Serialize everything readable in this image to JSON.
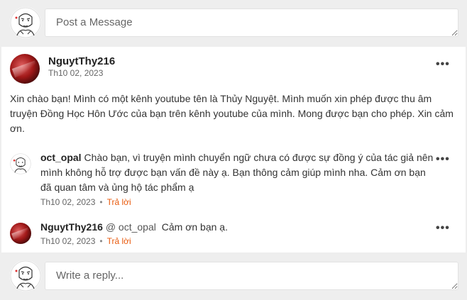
{
  "composer": {
    "placeholder": "Post a Message"
  },
  "post": {
    "username": "NguytThy216",
    "date": "Th10 02, 2023",
    "body": "Xin chào bạn!  Mình có một kênh youtube tên là Thủy Nguyệt.  Mình muốn xin phép được thu âm truyện Đồng Học Hôn Ước của bạn trên kênh youtube của mình.  Mong được bạn cho phép. Xin cảm ơn.",
    "menu_icon": "more-horizontal-icon"
  },
  "replies": [
    {
      "username": "oct_opal",
      "text": "Chào bạn, vì truyện mình chuyển ngữ chưa có được sự đồng ý của tác giả nên mình không hỗ trợ được bạn vấn đề này ạ. Bạn thông cảm giúp mình nha. Cảm ơn bạn đã quan tâm và ủng hộ tác phẩm ạ",
      "mention": "",
      "date": "Th10 02, 2023",
      "reply_label": "Trả lời"
    },
    {
      "username": "NguytThy216",
      "mention": "@ oct_opal",
      "text": "Cảm ơn bạn ạ.",
      "date": "Th10 02, 2023",
      "reply_label": "Trả lời"
    }
  ],
  "reply_composer": {
    "placeholder": "Write a reply..."
  },
  "colors": {
    "accent": "#e8590c",
    "background": "#eeeeee",
    "card": "#ffffff"
  }
}
